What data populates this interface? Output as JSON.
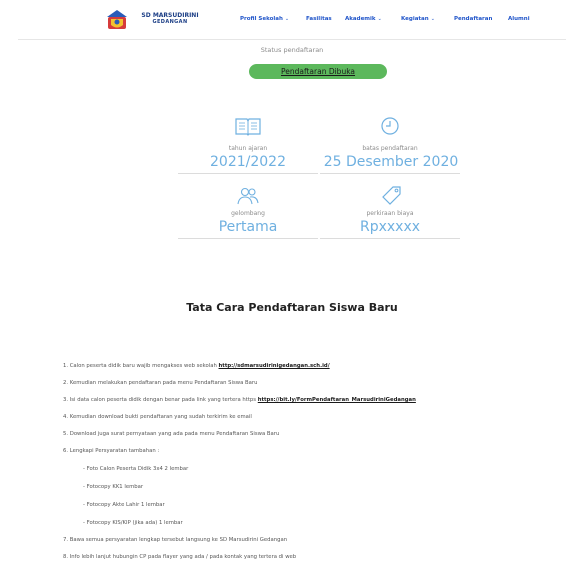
{
  "navbar": {
    "brand_line1": "SD MARSUDIRINI",
    "brand_line2": "GEDANGAN",
    "items": [
      {
        "label": "Profil Sekolah",
        "has_dropdown": true
      },
      {
        "label": "Fasilitas",
        "has_dropdown": false
      },
      {
        "label": "Akademik",
        "has_dropdown": true
      },
      {
        "label": "Kegiatan",
        "has_dropdown": true
      },
      {
        "label": "Pendaftaran",
        "has_dropdown": false
      },
      {
        "label": "Alumni",
        "has_dropdown": false
      }
    ],
    "dropdown_glyph": "⌄"
  },
  "status": {
    "label": "Status pendaftaran",
    "badge": "Pendaftaran Dibuka",
    "badge_color": "#5cb85c"
  },
  "info": {
    "academic_year": {
      "icon": "book-icon",
      "label": "tahun ajaran",
      "value": "2021/2022"
    },
    "deadline": {
      "icon": "clock-icon",
      "label": "batas pendaftaran",
      "value": "25 Desember 2020"
    },
    "wave": {
      "icon": "users-icon",
      "label": "gelombang",
      "value": "Pertama"
    },
    "cost": {
      "icon": "tag-icon",
      "label": "perkiraan biaya",
      "value": "Rpxxxxx"
    },
    "accent_color": "#6fb0e0"
  },
  "procedure": {
    "title": "Tata Cara Pendaftaran Siswa Baru",
    "steps": [
      {
        "text": "1. Calon peserta didik baru wajib mengakses web sekolah ",
        "link": "http://sdmarsudirinigedangan.sch.id/"
      },
      {
        "text": "2. Kemudian melakukan pendaftaran pada menu Pendaftaran Siswa Baru"
      },
      {
        "text": "3. Isi data calon peserta didik dengan benar pada link yang tertera https ",
        "link": "https://bit.ly/FormPendaftaran_MarsudiriniGedangan"
      },
      {
        "text": "4. Kemudian download bukti pendaftaran yang sudah terkirim ke email"
      },
      {
        "text": "5. Download juga surat pernyataan yang ada pada menu Pendaftaran Siswa Baru"
      },
      {
        "text": "6. Lengkapi Persyaratan tambahan :"
      },
      {
        "text": "- Foto Calon Peserta Didik 3x4 2 lembar",
        "sub": true
      },
      {
        "text": "- Fotocopy KK1 lembar",
        "sub": true
      },
      {
        "text": "- Fotocopy Akte Lahir 1 lembar",
        "sub": true
      },
      {
        "text": "- Fotocopy KIS/KIP (jika ada) 1 lembar",
        "sub": true
      },
      {
        "text": "7. Bawa semua persyaratan lengkap tersebut langsung ke SD Marsudirini Gedangan"
      },
      {
        "text": "8. Info lebih lanjut hubungin CP pada flayer yang ada / pada kontak yang tertera di web"
      }
    ]
  }
}
